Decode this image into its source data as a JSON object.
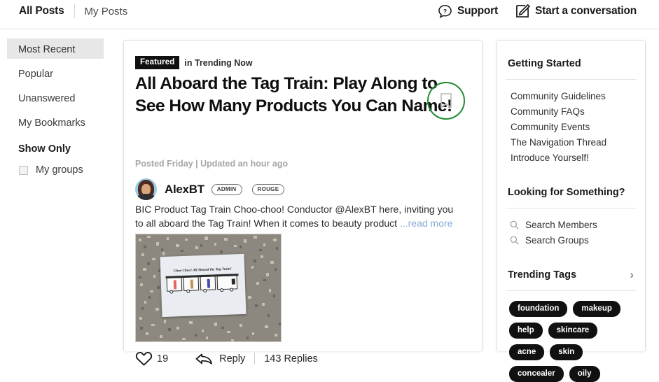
{
  "topbar": {
    "all_posts": "All Posts",
    "my_posts": "My Posts",
    "support": "Support",
    "start_conversation": "Start a conversation",
    "support_icon": "question-speech-bubble-icon",
    "compose_icon": "pencil-square-icon"
  },
  "sidebar": {
    "items": [
      {
        "label": "Most Recent",
        "active": true
      },
      {
        "label": "Popular",
        "active": false
      },
      {
        "label": "Unanswered",
        "active": false
      },
      {
        "label": "My Bookmarks",
        "active": false
      }
    ],
    "show_only_heading": "Show Only",
    "my_groups_label": "My groups",
    "my_groups_checked": false
  },
  "post": {
    "featured_badge": "Featured",
    "category_prefix": "in Trending Now",
    "title": "All Aboard the Tag Train: Play Along to See How Many Products You Can Name!",
    "meta": "Posted Friday  |  Updated an hour ago",
    "bookmark_icon": "bookmark-icon",
    "bookmark_ring_color": "#1e8b30",
    "author": {
      "name": "AlexBT",
      "badge_admin": "ADMIN",
      "badge_rouge": "ROUGE",
      "avatar_icon": "user-avatar-photo"
    },
    "body_text": "BIC Product Tag Train Choo-choo! Conductor @AlexBT here, inviting you to all aboard the Tag Train! When it comes to beauty product ",
    "read_more": "...read more",
    "read_more_color": "#8aa9d6",
    "image_caption": "Choo Choo! All Aboard the Tag Train!",
    "footer": {
      "like_icon": "heart-icon",
      "like_count": "19",
      "reply_icon": "reply-arrow-icon",
      "reply_label": "Reply",
      "replies_count": "143 Replies"
    }
  },
  "right_panel": {
    "getting_started_heading": "Getting Started",
    "getting_started_links": [
      "Community Guidelines",
      "Community FAQs",
      "Community Events",
      "The Navigation Thread",
      "Introduce Yourself!"
    ],
    "looking_heading": "Looking for Something?",
    "search_links": [
      {
        "label": "Search Members",
        "icon": "search-icon"
      },
      {
        "label": "Search Groups",
        "icon": "search-icon"
      }
    ],
    "trending_heading": "Trending Tags",
    "trending_chevron": "chevron-right-icon",
    "tags": [
      "foundation",
      "makeup",
      "help",
      "skincare",
      "acne",
      "skin",
      "concealer",
      "oily"
    ]
  }
}
